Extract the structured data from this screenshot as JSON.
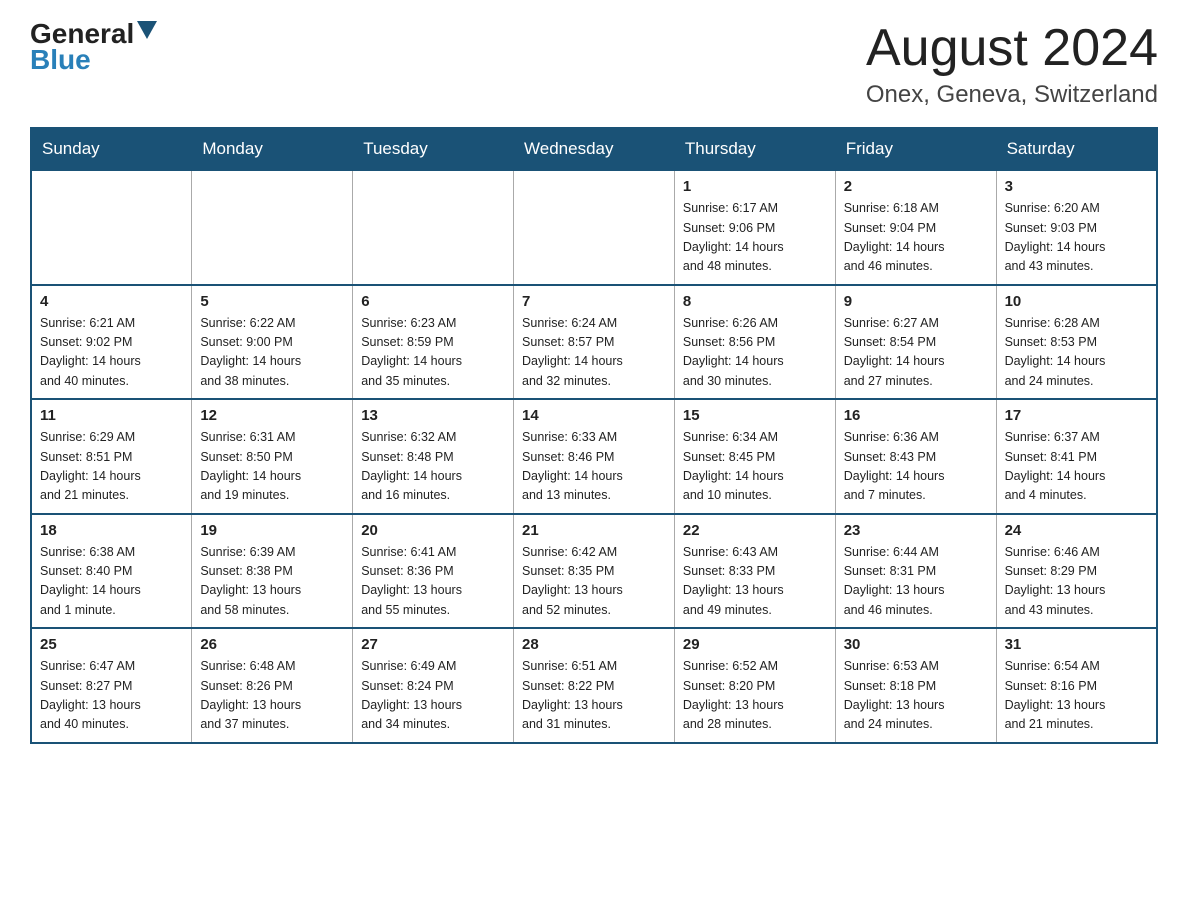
{
  "header": {
    "logo": {
      "general": "General",
      "blue": "Blue"
    },
    "title": "August 2024",
    "subtitle": "Onex, Geneva, Switzerland"
  },
  "calendar": {
    "weekdays": [
      "Sunday",
      "Monday",
      "Tuesday",
      "Wednesday",
      "Thursday",
      "Friday",
      "Saturday"
    ],
    "weeks": [
      [
        {
          "day": "",
          "info": ""
        },
        {
          "day": "",
          "info": ""
        },
        {
          "day": "",
          "info": ""
        },
        {
          "day": "",
          "info": ""
        },
        {
          "day": "1",
          "info": "Sunrise: 6:17 AM\nSunset: 9:06 PM\nDaylight: 14 hours\nand 48 minutes."
        },
        {
          "day": "2",
          "info": "Sunrise: 6:18 AM\nSunset: 9:04 PM\nDaylight: 14 hours\nand 46 minutes."
        },
        {
          "day": "3",
          "info": "Sunrise: 6:20 AM\nSunset: 9:03 PM\nDaylight: 14 hours\nand 43 minutes."
        }
      ],
      [
        {
          "day": "4",
          "info": "Sunrise: 6:21 AM\nSunset: 9:02 PM\nDaylight: 14 hours\nand 40 minutes."
        },
        {
          "day": "5",
          "info": "Sunrise: 6:22 AM\nSunset: 9:00 PM\nDaylight: 14 hours\nand 38 minutes."
        },
        {
          "day": "6",
          "info": "Sunrise: 6:23 AM\nSunset: 8:59 PM\nDaylight: 14 hours\nand 35 minutes."
        },
        {
          "day": "7",
          "info": "Sunrise: 6:24 AM\nSunset: 8:57 PM\nDaylight: 14 hours\nand 32 minutes."
        },
        {
          "day": "8",
          "info": "Sunrise: 6:26 AM\nSunset: 8:56 PM\nDaylight: 14 hours\nand 30 minutes."
        },
        {
          "day": "9",
          "info": "Sunrise: 6:27 AM\nSunset: 8:54 PM\nDaylight: 14 hours\nand 27 minutes."
        },
        {
          "day": "10",
          "info": "Sunrise: 6:28 AM\nSunset: 8:53 PM\nDaylight: 14 hours\nand 24 minutes."
        }
      ],
      [
        {
          "day": "11",
          "info": "Sunrise: 6:29 AM\nSunset: 8:51 PM\nDaylight: 14 hours\nand 21 minutes."
        },
        {
          "day": "12",
          "info": "Sunrise: 6:31 AM\nSunset: 8:50 PM\nDaylight: 14 hours\nand 19 minutes."
        },
        {
          "day": "13",
          "info": "Sunrise: 6:32 AM\nSunset: 8:48 PM\nDaylight: 14 hours\nand 16 minutes."
        },
        {
          "day": "14",
          "info": "Sunrise: 6:33 AM\nSunset: 8:46 PM\nDaylight: 14 hours\nand 13 minutes."
        },
        {
          "day": "15",
          "info": "Sunrise: 6:34 AM\nSunset: 8:45 PM\nDaylight: 14 hours\nand 10 minutes."
        },
        {
          "day": "16",
          "info": "Sunrise: 6:36 AM\nSunset: 8:43 PM\nDaylight: 14 hours\nand 7 minutes."
        },
        {
          "day": "17",
          "info": "Sunrise: 6:37 AM\nSunset: 8:41 PM\nDaylight: 14 hours\nand 4 minutes."
        }
      ],
      [
        {
          "day": "18",
          "info": "Sunrise: 6:38 AM\nSunset: 8:40 PM\nDaylight: 14 hours\nand 1 minute."
        },
        {
          "day": "19",
          "info": "Sunrise: 6:39 AM\nSunset: 8:38 PM\nDaylight: 13 hours\nand 58 minutes."
        },
        {
          "day": "20",
          "info": "Sunrise: 6:41 AM\nSunset: 8:36 PM\nDaylight: 13 hours\nand 55 minutes."
        },
        {
          "day": "21",
          "info": "Sunrise: 6:42 AM\nSunset: 8:35 PM\nDaylight: 13 hours\nand 52 minutes."
        },
        {
          "day": "22",
          "info": "Sunrise: 6:43 AM\nSunset: 8:33 PM\nDaylight: 13 hours\nand 49 minutes."
        },
        {
          "day": "23",
          "info": "Sunrise: 6:44 AM\nSunset: 8:31 PM\nDaylight: 13 hours\nand 46 minutes."
        },
        {
          "day": "24",
          "info": "Sunrise: 6:46 AM\nSunset: 8:29 PM\nDaylight: 13 hours\nand 43 minutes."
        }
      ],
      [
        {
          "day": "25",
          "info": "Sunrise: 6:47 AM\nSunset: 8:27 PM\nDaylight: 13 hours\nand 40 minutes."
        },
        {
          "day": "26",
          "info": "Sunrise: 6:48 AM\nSunset: 8:26 PM\nDaylight: 13 hours\nand 37 minutes."
        },
        {
          "day": "27",
          "info": "Sunrise: 6:49 AM\nSunset: 8:24 PM\nDaylight: 13 hours\nand 34 minutes."
        },
        {
          "day": "28",
          "info": "Sunrise: 6:51 AM\nSunset: 8:22 PM\nDaylight: 13 hours\nand 31 minutes."
        },
        {
          "day": "29",
          "info": "Sunrise: 6:52 AM\nSunset: 8:20 PM\nDaylight: 13 hours\nand 28 minutes."
        },
        {
          "day": "30",
          "info": "Sunrise: 6:53 AM\nSunset: 8:18 PM\nDaylight: 13 hours\nand 24 minutes."
        },
        {
          "day": "31",
          "info": "Sunrise: 6:54 AM\nSunset: 8:16 PM\nDaylight: 13 hours\nand 21 minutes."
        }
      ]
    ]
  }
}
